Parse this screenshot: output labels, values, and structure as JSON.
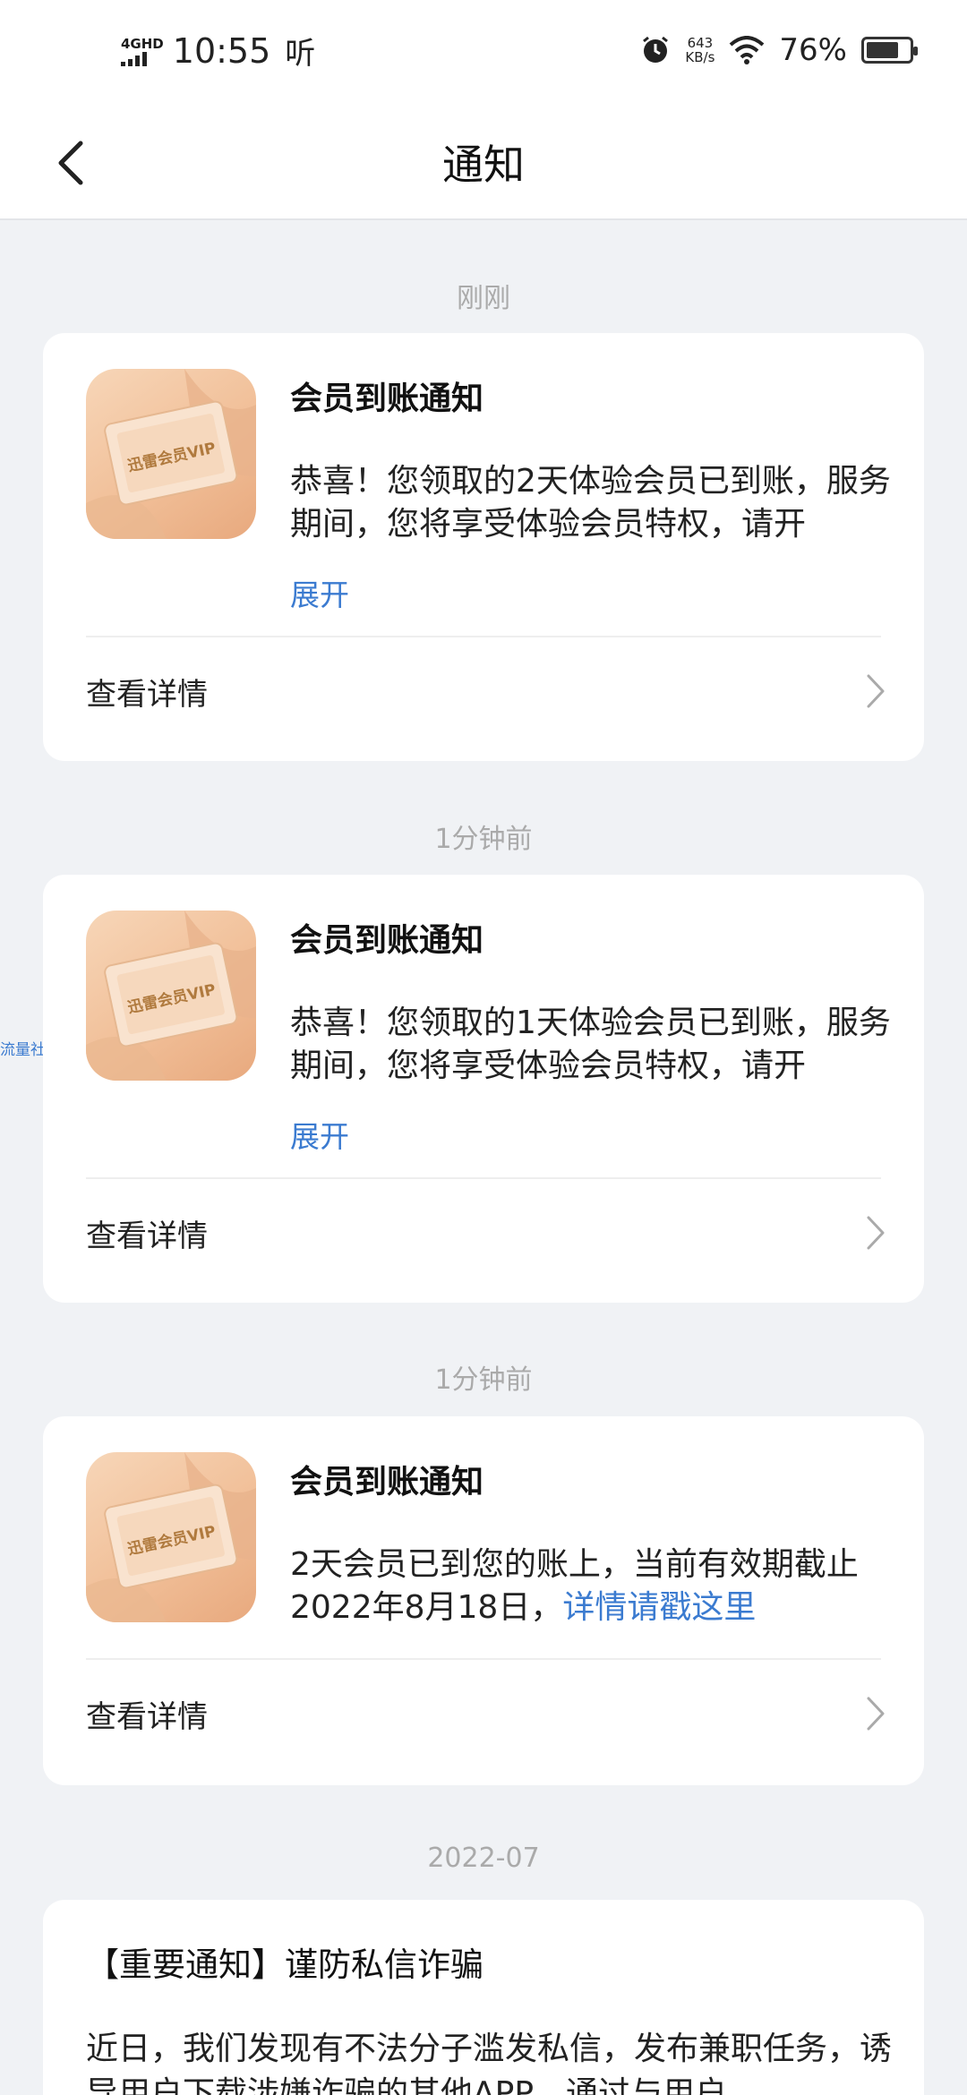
{
  "status_bar": {
    "network": "4GHD",
    "time": "10:55",
    "listen": "听",
    "speed_value": "643",
    "speed_unit": "KB/s",
    "battery": "76%"
  },
  "nav": {
    "title": "通知"
  },
  "groups": [
    {
      "time_label": "刚刚"
    },
    {
      "time_label": "1分钟前"
    },
    {
      "time_label": "1分钟前"
    },
    {
      "time_label": "2022-07"
    }
  ],
  "cards": [
    {
      "title": "会员到账通知",
      "body": "恭喜！您领取的2天体验会员已到账，服务期间，您将享受体验会员特权，请开",
      "expand": "展开",
      "detail": "查看详情",
      "icon_text": "迅雷会员VIP"
    },
    {
      "title": "会员到账通知",
      "body": "恭喜！您领取的1天体验会员已到账，服务期间，您将享受体验会员特权，请开",
      "expand": "展开",
      "detail": "查看详情",
      "icon_text": "迅雷会员VIP"
    },
    {
      "title": "会员到账通知",
      "body": "2天会员已到您的账上，当前有效期截止2022年8月18日，",
      "body_link": "详情请戳这里",
      "detail": "查看详情",
      "icon_text": "迅雷会员VIP"
    },
    {
      "title": "【重要通知】谨防私信诈骗",
      "body": "近日，我们发现有不法分子滥发私信，发布兼职任务，诱导用户下载涉嫌诈骗的其他APP，通过与用户"
    }
  ],
  "watermark": "流量社区",
  "colors": {
    "accent": "#3b7bd0",
    "background": "#f0f2f5"
  }
}
